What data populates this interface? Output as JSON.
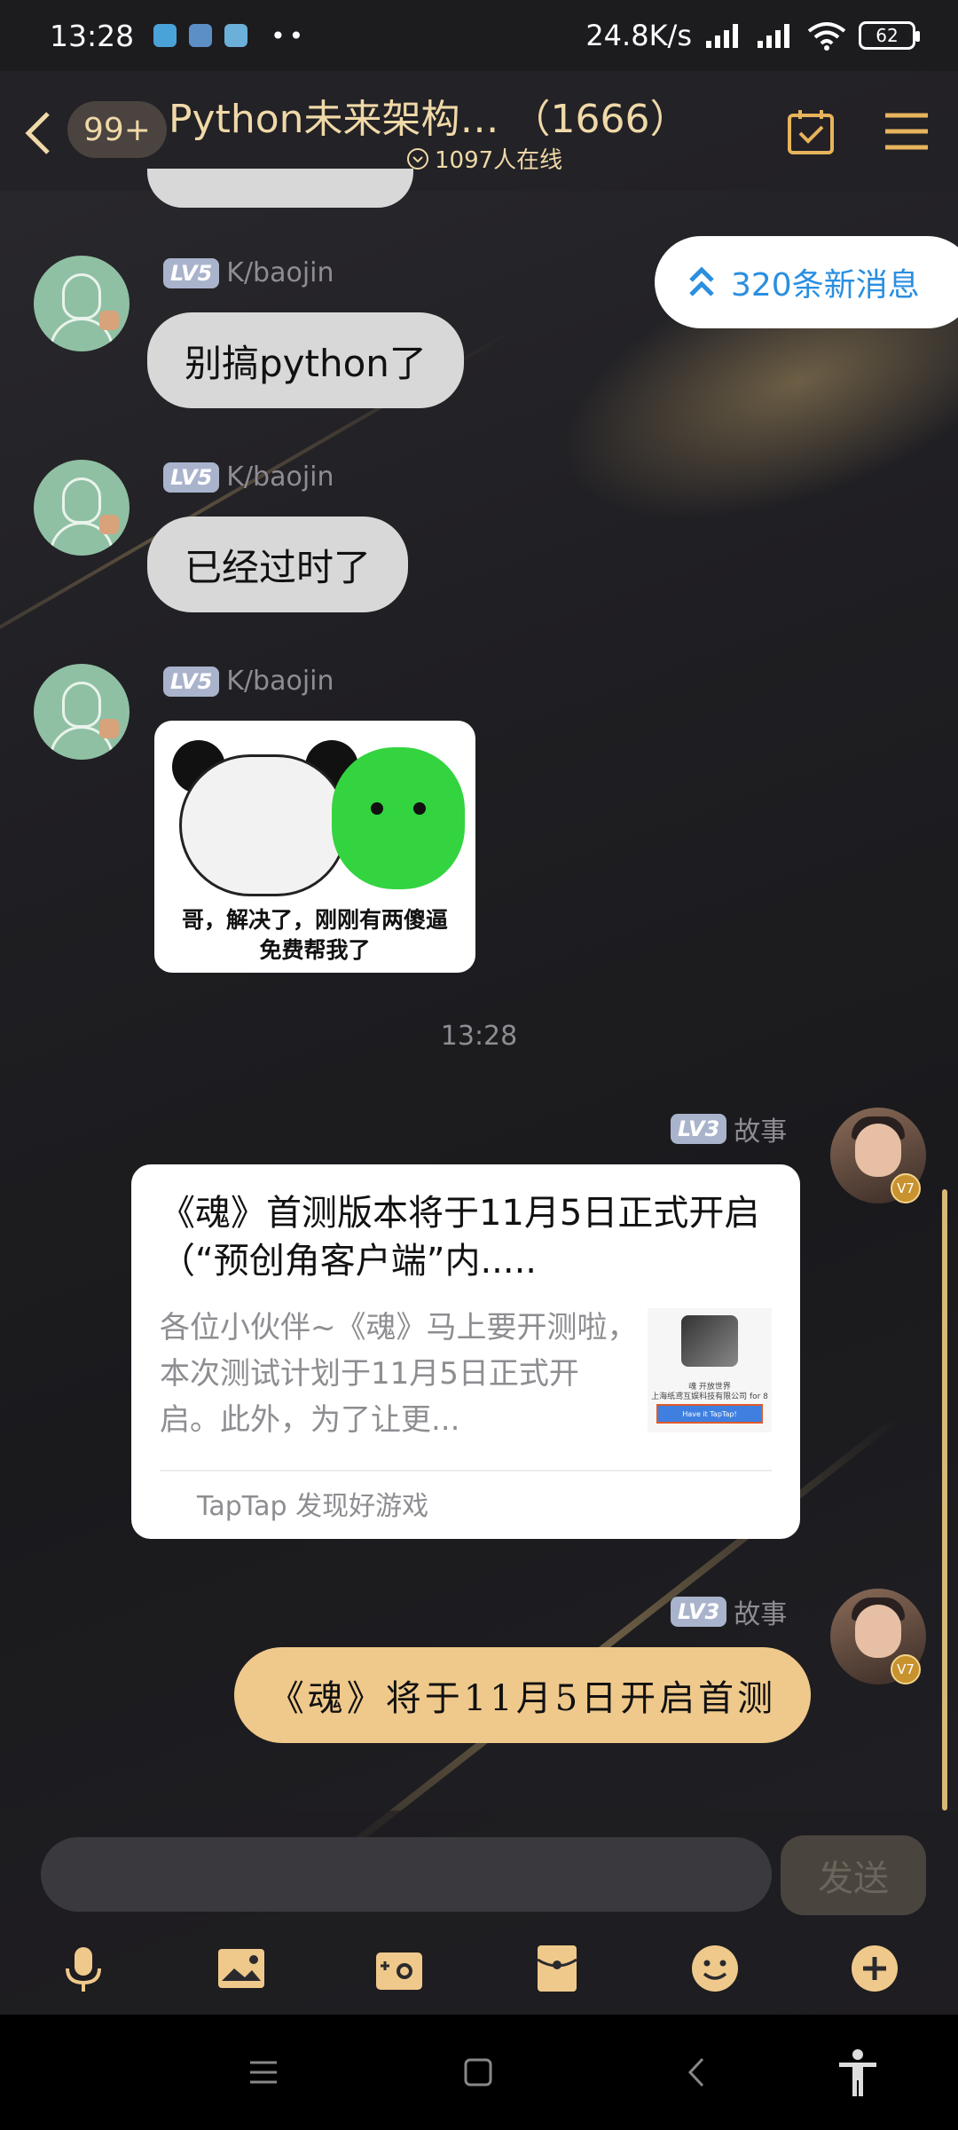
{
  "status_bar": {
    "time": "13:28",
    "network_speed": "24.8K/s",
    "battery": "62",
    "dots": "••"
  },
  "header": {
    "unread_badge": "99+",
    "group_title": "Python未来架构… （1666）",
    "online_count": "1097人在线"
  },
  "new_messages_pill": "320条新消息",
  "messages": [
    {
      "level": "LV5",
      "sender": "K/baojin",
      "text": "别搞python了"
    },
    {
      "level": "LV5",
      "sender": "K/baojin",
      "text": "已经过时了"
    },
    {
      "level": "LV5",
      "sender": "K/baojin",
      "sticker_caption": "哥，解决了，刚刚有两傻逼\n免费帮我了"
    }
  ],
  "timestamp": "13:28",
  "card_message": {
    "level": "LV3",
    "sender": "故事",
    "vip": "V7",
    "title": "《魂》首测版本将于11月5日正式开启（“预创角客户端”内.....",
    "description": "各位小伙伴~《魂》马上要开测啦，本次测试计划于11月5日正式开启。此外，为了让更...",
    "thumb_text": "魂 开放世界\n上海纸鸢互娱科技有限公司 for 8",
    "thumb_button": "Have it TapTap!",
    "source": "TapTap 发现好游戏"
  },
  "my_message": {
    "level": "LV3",
    "sender": "故事",
    "vip": "V7",
    "text": "《魂》将于11月5日开启首测"
  },
  "input": {
    "placeholder": "",
    "send_label": "发送"
  },
  "colors": {
    "accent_gold": "#f0d9a8",
    "my_bubble": "#efc98b",
    "link_blue": "#2a8fe0",
    "level_badge": "#a9b3cc"
  },
  "icons": [
    "back-icon",
    "calendar-check-icon",
    "menu-icon",
    "double-chevron-up-icon",
    "microphone-icon",
    "image-icon",
    "camera-icon",
    "red-packet-icon",
    "emoji-icon",
    "plus-icon",
    "nav-menu-icon",
    "nav-home-icon",
    "nav-back-icon",
    "accessibility-icon"
  ]
}
